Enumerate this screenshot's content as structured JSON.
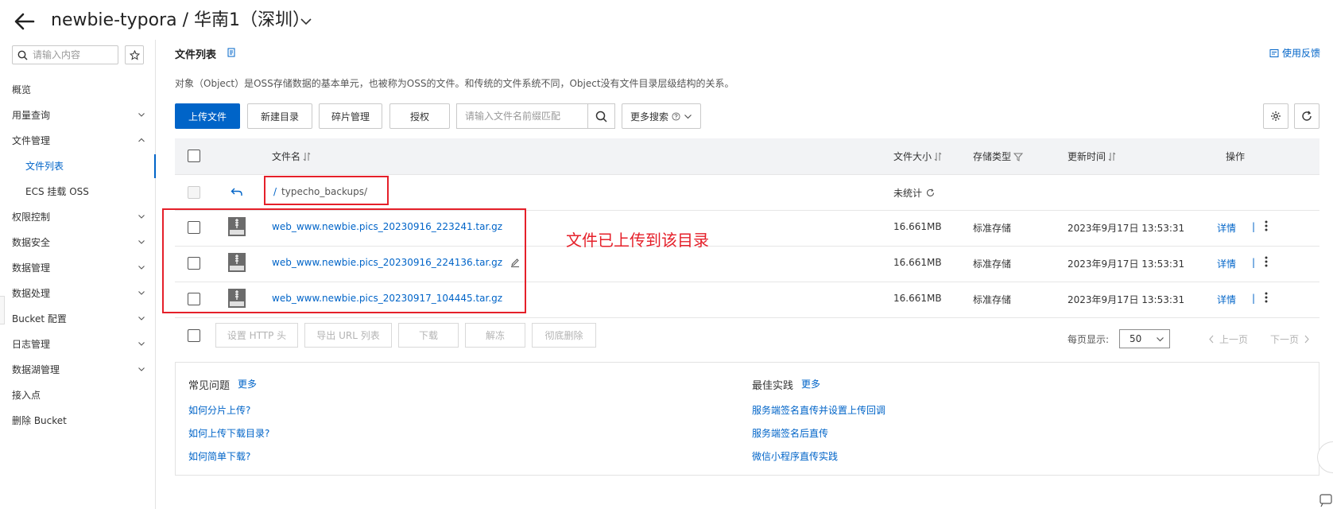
{
  "header": {
    "title": "newbie-typora / 华南1（深圳）"
  },
  "sidebar": {
    "search_placeholder": "请输入内容",
    "items": [
      {
        "label": "概览",
        "has_chevron": false
      },
      {
        "label": "用量查询",
        "has_chevron": true
      },
      {
        "label": "文件管理",
        "has_chevron": true,
        "expanded": true
      },
      {
        "label": "文件列表",
        "sub": true,
        "active": true
      },
      {
        "label": "ECS 挂载 OSS",
        "sub": true
      },
      {
        "label": "权限控制",
        "has_chevron": true
      },
      {
        "label": "数据安全",
        "has_chevron": true
      },
      {
        "label": "数据管理",
        "has_chevron": true
      },
      {
        "label": "数据处理",
        "has_chevron": true
      },
      {
        "label": "Bucket 配置",
        "has_chevron": true
      },
      {
        "label": "日志管理",
        "has_chevron": true
      },
      {
        "label": "数据湖管理",
        "has_chevron": true
      },
      {
        "label": "接入点",
        "has_chevron": false
      },
      {
        "label": "删除 Bucket",
        "has_chevron": false
      }
    ]
  },
  "main": {
    "section_title": "文件列表",
    "feedback_label": "使用反馈",
    "description": "对象（Object）是OSS存储数据的基本单元，也被称为OSS的文件。和传统的文件系统不同，Object没有文件目录层级结构的关系。",
    "toolbar": {
      "upload": "上传文件",
      "new_dir": "新建目录",
      "fragments": "碎片管理",
      "authorize": "授权",
      "search_placeholder": "请输入文件名前缀匹配",
      "more_search": "更多搜索"
    },
    "table": {
      "headers": {
        "name": "文件名",
        "size": "文件大小",
        "storage": "存储类型",
        "updated": "更新时间",
        "actions": "操作"
      },
      "parent_dir": {
        "path": "typecho_backups/",
        "size": "未统计"
      },
      "rows": [
        {
          "name": "web_www.newbie.pics_20230916_223241.tar.gz",
          "size": "16.661MB",
          "storage": "标准存储",
          "updated": "2023年9月17日 13:53:31",
          "detail": "详情"
        },
        {
          "name": "web_www.newbie.pics_20230916_224136.tar.gz",
          "size": "16.661MB",
          "storage": "标准存储",
          "updated": "2023年9月17日 13:53:31",
          "detail": "详情"
        },
        {
          "name": "web_www.newbie.pics_20230917_104445.tar.gz",
          "size": "16.661MB",
          "storage": "标准存储",
          "updated": "2023年9月17日 13:53:31",
          "detail": "详情"
        }
      ],
      "separator": "|"
    },
    "annotation": "文件已上传到该目录",
    "bulk_actions": {
      "http_header": "设置 HTTP 头",
      "export_url": "导出 URL 列表",
      "download": "下载",
      "unfreeze": "解冻",
      "delete": "彻底删除"
    },
    "pagination": {
      "per_page_label": "每页显示:",
      "per_page_value": "50",
      "prev": "上一页",
      "next": "下一页"
    },
    "faq": {
      "left_title": "常见问题",
      "right_title": "最佳实践",
      "more": "更多",
      "left_links": [
        "如何分片上传?",
        "如何上传下载目录?",
        "如何简单下载?"
      ],
      "right_links": [
        "服务端签名直传并设置上传回调",
        "服务端签名后直传",
        "微信小程序直传实践"
      ]
    }
  },
  "colors": {
    "accent": "#0064c8",
    "annotation_red": "#e5202a"
  }
}
